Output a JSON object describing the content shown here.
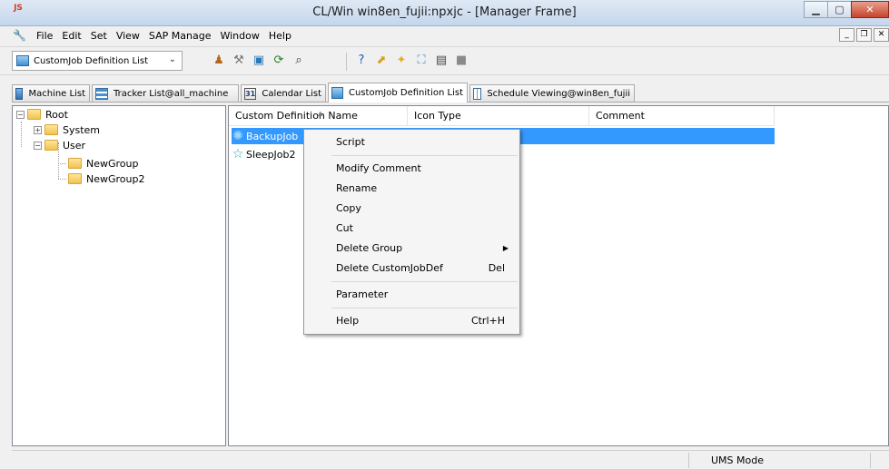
{
  "window": {
    "title": "CL/Win win8en_fujii:npxjc - [Manager Frame]",
    "app_icon_text": "JS"
  },
  "menubar": {
    "items": [
      "File",
      "Edit",
      "Set",
      "View",
      "SAP Manage",
      "Window",
      "Help"
    ]
  },
  "toolbar": {
    "view_selector": "CustomJob Definition List",
    "tools": [
      "user-icon",
      "wrench-icon",
      "monitor-icon",
      "refresh-icon",
      "find-icon",
      "help-icon",
      "export-icon",
      "new-icon",
      "job-icon",
      "schedule-icon",
      "stop-icon"
    ]
  },
  "tabs": [
    {
      "label": "Machine List",
      "active": false
    },
    {
      "label": "Tracker List@all_machine",
      "active": false
    },
    {
      "label": "Calendar List",
      "active": false
    },
    {
      "label": "CustomJob Definition List",
      "active": true
    },
    {
      "label": "Schedule Viewing@win8en_fujii",
      "active": false
    }
  ],
  "calendar_tab_icon_text": "31",
  "tree": {
    "root": "Root",
    "system": "System",
    "user": "User",
    "new_group": "NewGroup",
    "new_group2": "NewGroup2"
  },
  "list": {
    "columns": [
      "Custom Definition Name",
      "Icon Type",
      "Comment"
    ],
    "rows": [
      {
        "name": "BackupJob",
        "selected": true
      },
      {
        "name": "SleepJob2",
        "selected": false
      }
    ]
  },
  "context_menu": {
    "script": "Script",
    "modify_comment": "Modify Comment",
    "rename": "Rename",
    "copy": "Copy",
    "cut": "Cut",
    "delete_group": "Delete Group",
    "delete_customjobdef": "Delete CustomJobDef",
    "delete_customjobdef_shortcut": "Del",
    "parameter": "Parameter",
    "help": "Help",
    "help_shortcut": "Ctrl+H"
  },
  "statusbar": {
    "mode": "UMS Mode"
  },
  "colors": {
    "selection": "#3399ff",
    "folder": "#f2c24f"
  }
}
